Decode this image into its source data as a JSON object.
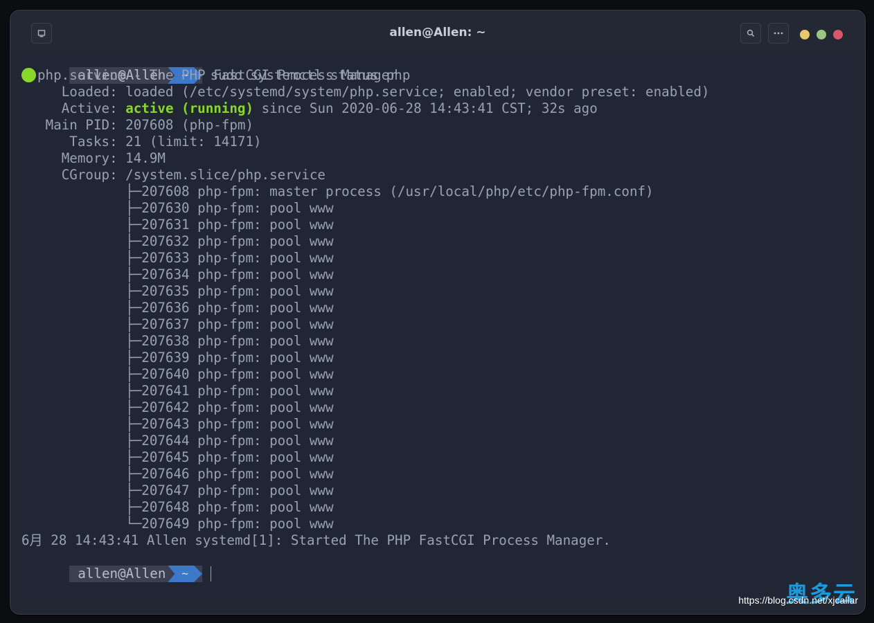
{
  "window": {
    "title": "allen@Allen: ~",
    "icons": {
      "tab": "terminal-tab-icon",
      "search": "search-icon",
      "menu": "more-icon"
    },
    "controls": {
      "minimize_color": "#e9c86a",
      "maximize_color": "#9dc581",
      "close_color": "#d9576b"
    }
  },
  "prompt": {
    "user": "allen@Allen",
    "dir": "~"
  },
  "command": "sudo systemctl status php",
  "status": {
    "unit_line": "php.service - The PHP FastCGI Process Manager",
    "loaded": "     Loaded: loaded (/etc/systemd/system/php.service; enabled; vendor preset: enabled)",
    "active_label": "     Active: ",
    "active_state": "active (running)",
    "active_rest": " since Sun 2020-06-28 14:43:41 CST; 32s ago",
    "main_pid": "   Main PID: 207608 (php-fpm)",
    "tasks": "      Tasks: 21 (limit: 14171)",
    "memory": "     Memory: 14.9M",
    "cgroup": "     CGroup: /system.slice/php.service",
    "processes": [
      "             ├─207608 php-fpm: master process (/usr/local/php/etc/php-fpm.conf)",
      "             ├─207630 php-fpm: pool www",
      "             ├─207631 php-fpm: pool www",
      "             ├─207632 php-fpm: pool www",
      "             ├─207633 php-fpm: pool www",
      "             ├─207634 php-fpm: pool www",
      "             ├─207635 php-fpm: pool www",
      "             ├─207636 php-fpm: pool www",
      "             ├─207637 php-fpm: pool www",
      "             ├─207638 php-fpm: pool www",
      "             ├─207639 php-fpm: pool www",
      "             ├─207640 php-fpm: pool www",
      "             ├─207641 php-fpm: pool www",
      "             ├─207642 php-fpm: pool www",
      "             ├─207643 php-fpm: pool www",
      "             ├─207644 php-fpm: pool www",
      "             ├─207645 php-fpm: pool www",
      "             ├─207646 php-fpm: pool www",
      "             ├─207647 php-fpm: pool www",
      "             ├─207648 php-fpm: pool www",
      "             └─207649 php-fpm: pool www"
    ],
    "log_line": "6月 28 14:43:41 Allen systemd[1]: Started The PHP FastCGI Process Manager."
  },
  "watermark": {
    "url": "https://blog.csdn.net/xjcallar",
    "cn": "奥多云"
  },
  "colors": {
    "bg": "#212634",
    "text": "#98a2b3",
    "green": "#8ad72c",
    "prompt_dir": "#3d78c9"
  }
}
